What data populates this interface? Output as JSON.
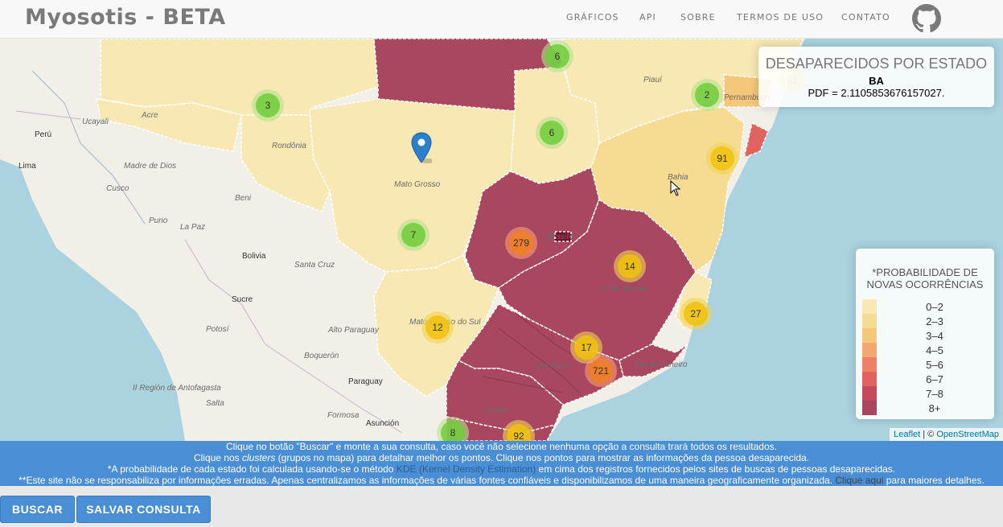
{
  "brand": "Myosotis - BETA",
  "nav": [
    {
      "label": "GRÁFICOS"
    },
    {
      "label": "API"
    },
    {
      "label": "SOBRE"
    },
    {
      "label": "TERMOS DE USO"
    },
    {
      "label": "CONTATO"
    }
  ],
  "github_icon": "github-icon",
  "map": {
    "labels": {
      "acre": "Acre",
      "rondonia": "Rondônia",
      "mato_grosso": "Mato Grosso",
      "piaui": "Piauí",
      "pernambuco": "Pernambuco",
      "bahia": "Bahia",
      "minas": "Minas Gerais",
      "sao_paulo": "São Paulo",
      "rio": "Rio de Janeiro",
      "parana": "Paraná",
      "ms": "Mato Grosso do Sul",
      "brasilia": "Brasília"
    },
    "cities": {
      "peru": "Perú",
      "lima": "Lima",
      "ucayali": "Ucayali",
      "madre": "Madre de Dios",
      "cusco": "Cusco",
      "beni": "Beni",
      "puno": "Puno",
      "lapaz": "La Paz",
      "bolivia": "Bolivia",
      "santacruz": "Santa Cruz",
      "sucre": "Sucre",
      "potosi": "Potosí",
      "altoparaguay": "Alto Paraguay",
      "boqueron": "Boquerón",
      "paraguay": "Paraguay",
      "antofagasta": "II Región de Antofagasta",
      "salta": "Salta",
      "formosa": "Formosa",
      "asuncion": "Asunción"
    },
    "clusters": [
      "6",
      "3",
      "6",
      "2",
      "91",
      "7",
      "279",
      "14",
      "12",
      "27",
      "17",
      "721",
      "8",
      "92",
      "51"
    ],
    "marker_icon": "map-marker-icon"
  },
  "info": {
    "title": "DESAPARECIDOS POR ESTADO",
    "state": "BA",
    "pdf": "PDF = 2.1105853676157027."
  },
  "legend": {
    "title_line1": "*PROBABILIDADE DE",
    "title_line2": "NOVAS OCORRÊNCIAS",
    "items": [
      {
        "label": "0–2",
        "color": "#f8e8b4"
      },
      {
        "label": "2–3",
        "color": "#f6dc92"
      },
      {
        "label": "3–4",
        "color": "#f5c77a"
      },
      {
        "label": "4–5",
        "color": "#f3a872"
      },
      {
        "label": "5–6",
        "color": "#ec8168"
      },
      {
        "label": "6–7",
        "color": "#e06360"
      },
      {
        "label": "7–8",
        "color": "#c64a5e"
      },
      {
        "label": "8+",
        "color": "#a8475f"
      }
    ]
  },
  "attribution": {
    "leaflet": "Leaflet",
    "sep": " | © ",
    "osm": "OpenStreetMap"
  },
  "footer": {
    "line1": "Clique no botão \"Buscar\" e monte a sua consulta, caso você não selecione nenhuma opção a consulta trará todos os resultados.",
    "line2a": "Clique nos ",
    "line2b": "clusters",
    "line2c": " (grupos no mapa) para detalhar melhor os pontos. Clique nos pontos para mostrar as informações da pessoa desaparecida.",
    "line3a": "*A probabilidade de cada estado foi calculada usando-se o método ",
    "line3b": "KDE (Kernel Density Estimation)",
    "line3c": " em cima dos registros fornecidos pelos sites de buscas de pessoas desaparecidas.",
    "line4a": "**Este site não se responsabiliza por informações erradas. Apenas centralizamos as informações de várias fontes confiáveis e disponibilizamos de uma maneira geograficamente organizada. ",
    "line4b": "Clique aqui",
    "line4c": " para maiores detalhes."
  },
  "buttons": {
    "search": "BUSCAR",
    "save": "SALVAR CONSULTA"
  }
}
